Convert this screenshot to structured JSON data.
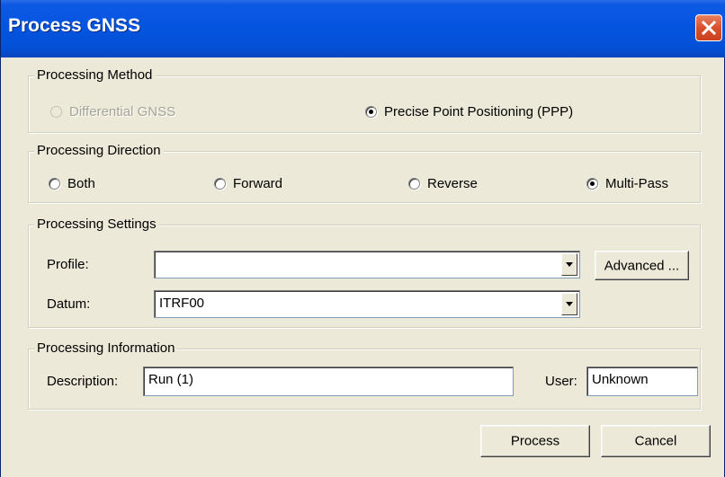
{
  "window": {
    "title": "Process GNSS",
    "close_icon": "close-icon"
  },
  "processing_method": {
    "title": "Processing Method",
    "options": [
      {
        "label": "Differential GNSS",
        "selected": false,
        "enabled": false
      },
      {
        "label": "Precise Point Positioning (PPP)",
        "selected": true,
        "enabled": true
      }
    ]
  },
  "processing_direction": {
    "title": "Processing Direction",
    "options": [
      {
        "label": "Both",
        "selected": false
      },
      {
        "label": "Forward",
        "selected": false
      },
      {
        "label": "Reverse",
        "selected": false
      },
      {
        "label": "Multi-Pass",
        "selected": true
      }
    ]
  },
  "processing_settings": {
    "title": "Processing Settings",
    "profile_label": "Profile:",
    "profile_value": "",
    "advanced_label": "Advanced ...",
    "datum_label": "Datum:",
    "datum_value": "ITRF00"
  },
  "processing_information": {
    "title": "Processing Information",
    "description_label": "Description:",
    "description_value": "Run (1)",
    "user_label": "User:",
    "user_value": "Unknown"
  },
  "footer": {
    "process_label": "Process",
    "cancel_label": "Cancel"
  },
  "colors": {
    "title_bar": "#0454e0",
    "dialog_bg": "#ece9d8",
    "close_button": "#d9502d"
  }
}
